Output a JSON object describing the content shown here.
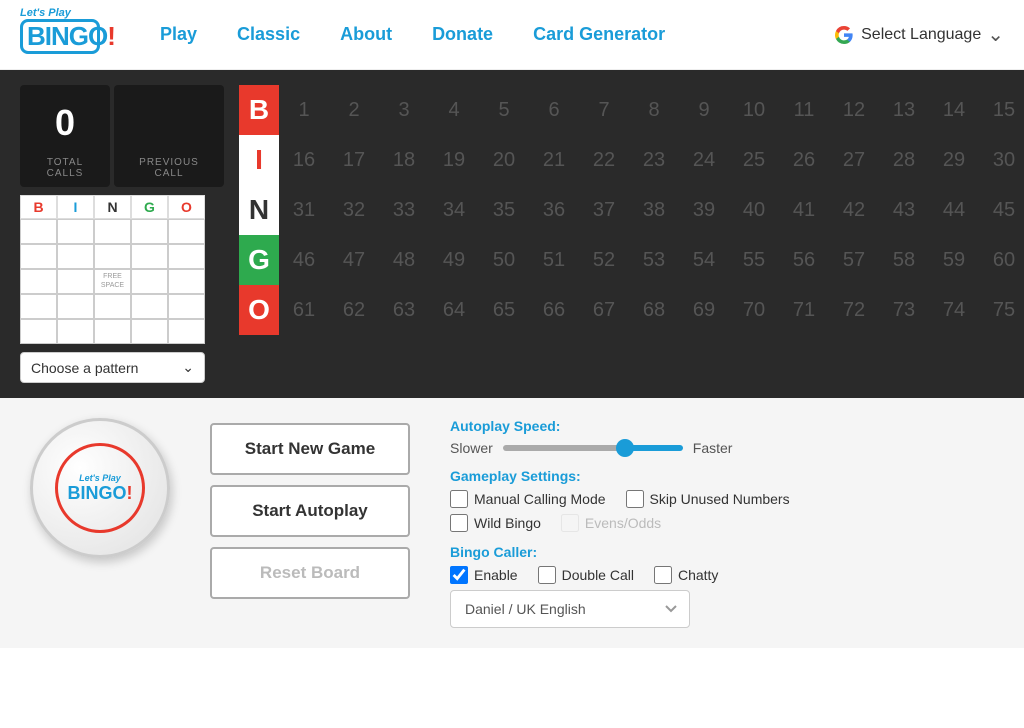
{
  "nav": {
    "logo_top": "Let's Play",
    "logo_main": "BINGO",
    "logo_exclaim": "!",
    "links": [
      "Play",
      "Classic",
      "About",
      "Donate",
      "Card Generator"
    ],
    "lang_label": "Select Language"
  },
  "game": {
    "total_calls": "0",
    "total_calls_label": "TOTAL CALLS",
    "prev_call_label": "PREVIOUS CALL",
    "bingo_letters": [
      "B",
      "I",
      "N",
      "G",
      "O"
    ],
    "card_header": [
      "B",
      "I",
      "N",
      "G",
      "O"
    ],
    "free_space_text": "FREE SPACE",
    "pattern_label": "Choose a pattern",
    "numbers": [
      [
        1,
        2,
        3,
        4,
        5,
        6,
        7,
        8,
        9,
        10,
        11,
        12,
        13,
        14,
        15
      ],
      [
        16,
        17,
        18,
        19,
        20,
        21,
        22,
        23,
        24,
        25,
        26,
        27,
        28,
        29,
        30
      ],
      [
        31,
        32,
        33,
        34,
        35,
        36,
        37,
        38,
        39,
        40,
        41,
        42,
        43,
        44,
        45
      ],
      [
        46,
        47,
        48,
        49,
        50,
        51,
        52,
        53,
        54,
        55,
        56,
        57,
        58,
        59,
        60
      ],
      [
        61,
        62,
        63,
        64,
        65,
        66,
        67,
        68,
        69,
        70,
        71,
        72,
        73,
        74,
        75
      ]
    ]
  },
  "bottom": {
    "ball_top": "Let's Play",
    "ball_main": "BINGO",
    "buttons": {
      "start_new": "Start New Game",
      "start_auto": "Start Autoplay",
      "reset": "Reset Board"
    },
    "autoplay": {
      "label": "Autoplay Speed:",
      "slower": "Slower",
      "faster": "Faster"
    },
    "gameplay": {
      "label": "Gameplay Settings:",
      "manual_calling": "Manual Calling Mode",
      "skip_unused": "Skip Unused Numbers",
      "wild_bingo": "Wild Bingo",
      "evens_odds": "Evens/Odds"
    },
    "caller": {
      "label": "Bingo Caller:",
      "enable": "Enable",
      "double_call": "Double Call",
      "chatty": "Chatty",
      "voice_option": "Daniel / UK English"
    }
  }
}
